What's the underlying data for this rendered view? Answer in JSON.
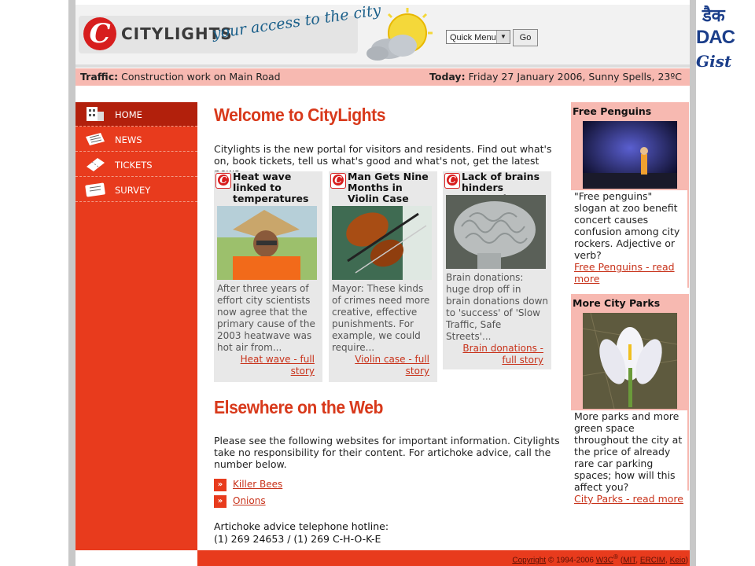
{
  "header": {
    "logo_text": "CITYLIGHTS",
    "tagline": "your access to the city",
    "quick_menu": "Quick Menu",
    "go_label": "Go"
  },
  "infobar": {
    "traffic_label": "Traffic:",
    "traffic_text": "Construction work on Main Road",
    "today_label": "Today:",
    "today_text": "Friday 27 January 2006, Sunny Spells, 23ºC"
  },
  "nav": {
    "items": [
      {
        "label": "HOME",
        "icon": "building-icon"
      },
      {
        "label": "NEWS",
        "icon": "newspaper-icon"
      },
      {
        "label": "TICKETS",
        "icon": "ticket-icon"
      },
      {
        "label": "SURVEY",
        "icon": "survey-icon"
      }
    ]
  },
  "main": {
    "welcome_title": "Welcome to CityLights",
    "welcome_text": "Citylights is the new portal for visitors and residents. Find out what's on, book tickets, tell us what's good and what's not, get the latest news.",
    "news": [
      {
        "title": "Heat wave linked to temperatures",
        "summary": "After three years of effort city scientists now agree that the primary cause of the 2003 heatwave was hot air from...",
        "more": "Heat wave - full story"
      },
      {
        "title": "Man Gets Nine Months in Violin Case",
        "summary": "Mayor: These kinds of crimes need more creative, effective punishments. For example, we could require...",
        "more": "Violin case - full story"
      },
      {
        "title": "Lack of brains hinders research",
        "summary": "Brain donations: huge drop off in brain donations down to 'success' of 'Slow Traffic, Safe Streets'...",
        "more": "Brain donations - full story"
      }
    ],
    "elsewhere_title": "Elsewhere on the Web",
    "elsewhere_text": "Please see the following websites for important information. Citylights take no responsibility for their content. For artichoke advice, call the number below.",
    "links": [
      "Killer Bees",
      "Onions"
    ],
    "hotline_label": "Artichoke advice telephone hotline:",
    "hotline_number": "(1) 269 24653 / (1) 269 C-H-O-K-E"
  },
  "right": {
    "boxes": [
      {
        "title": "Free Penguins",
        "text": "\"Free penguins\" slogan at zoo benefit concert causes confusion among city rockers. Adjective or verb?",
        "link": "Free Penguins - read more"
      },
      {
        "title": "More City Parks",
        "text": "More parks and more green space throughout the city at the price of already rare car parking spaces; how will this affect you?",
        "link": "City Parks - read more"
      }
    ]
  },
  "footer": {
    "copyright_link": "Copyright",
    "years": "© 1994-2006",
    "w3c": "W3C",
    "reg": "®",
    "mit": "MIT",
    "ercim": "ERCIM",
    "keio": "Keio"
  },
  "cdac": {
    "line1": "डैक",
    "line2": "DAC",
    "line3": "Gist"
  },
  "colors": {
    "brand_red": "#e83b1d",
    "nav_active": "#b2200c",
    "info_pink": "#f7b9b1",
    "heading_red": "#d8391b",
    "link_red": "#c8321a"
  }
}
